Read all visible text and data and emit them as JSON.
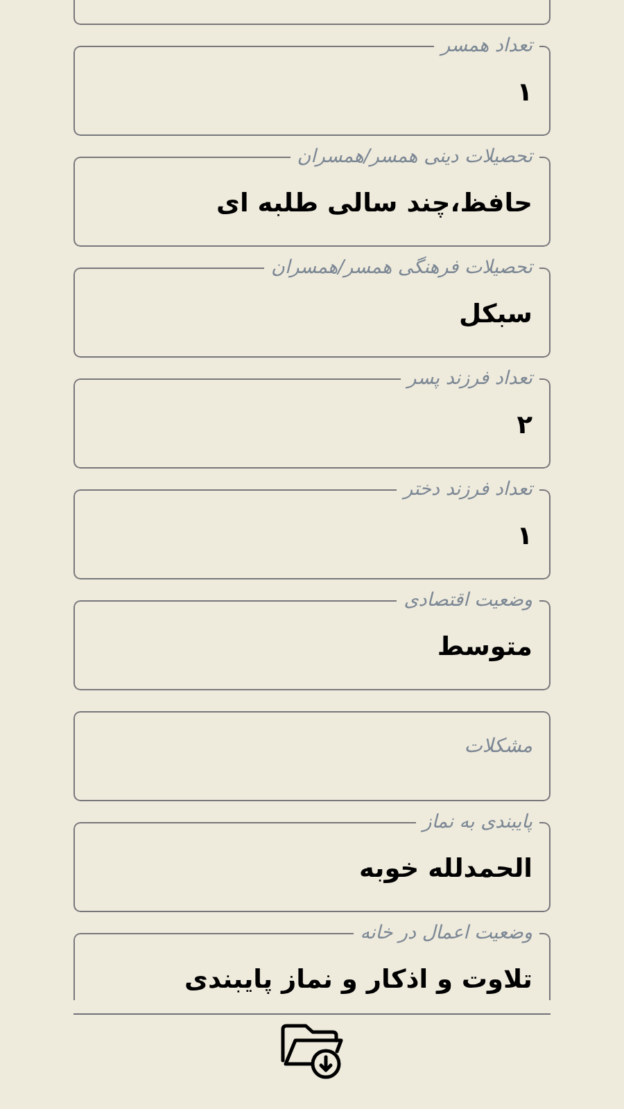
{
  "form": {
    "fields": [
      {
        "kind": "text"
      },
      {
        "kind": "text",
        "label": "تعداد همسر",
        "value": "۱"
      },
      {
        "kind": "text",
        "label": "تحصیلات دینی همسر/همسران",
        "value": "حافظ،چند سالی طلبه ای"
      },
      {
        "kind": "text",
        "label": "تحصیلات فرهنگی همسر/همسران",
        "value": "سبکل"
      },
      {
        "kind": "text",
        "label": "تعداد فرزند پسر",
        "value": "۲"
      },
      {
        "kind": "text",
        "label": "تعداد فرزند دختر",
        "value": "۱"
      },
      {
        "kind": "text",
        "label": "وضعیت اقتصادی",
        "value": "متوسط"
      },
      {
        "kind": "textarea",
        "placeholder": "مشکلات"
      },
      {
        "kind": "text",
        "label": "پایبندی به نماز",
        "value": "الحمدلله خوبه"
      },
      {
        "kind": "text",
        "label": "وضعیت اعمال در خانه",
        "value": "تلاوت و اذکار و نماز پایبندی"
      }
    ]
  }
}
